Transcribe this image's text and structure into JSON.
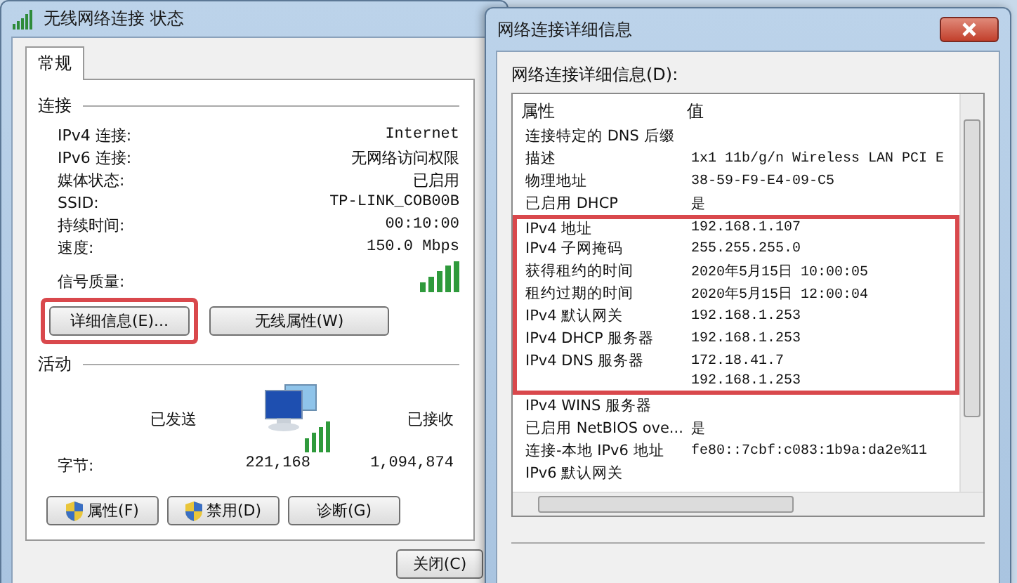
{
  "status_window": {
    "title": "无线网络连接 状态",
    "tabs": [
      {
        "label": "常规",
        "selected": true
      }
    ],
    "connection": {
      "heading": "连接",
      "fields": [
        {
          "label": "IPv4 连接:",
          "value": "Internet"
        },
        {
          "label": "IPv6 连接:",
          "value": "无网络访问权限"
        },
        {
          "label": "媒体状态:",
          "value": "已启用"
        },
        {
          "label": "SSID:",
          "value": "TP-LINK_COB00B"
        },
        {
          "label": "持续时间:",
          "value": "00:10:00"
        },
        {
          "label": "速度:",
          "value": "150.0 Mbps"
        }
      ],
      "signal_label": "信号质量:"
    },
    "buttons": [
      {
        "label": "详细信息(E)...",
        "highlighted": true
      },
      {
        "label": "无线属性(W)",
        "highlighted": false
      }
    ],
    "activity": {
      "heading": "活动",
      "sent_label": "已发送",
      "received_label": "已接收",
      "bytes_label": "字节:",
      "sent": "221,168",
      "received": "1,094,874"
    },
    "action_buttons": [
      {
        "label": "属性(F)",
        "kind": "shield"
      },
      {
        "label": "禁用(D)",
        "kind": "shield"
      },
      {
        "label": "诊断(G)",
        "kind": "plain"
      }
    ],
    "close_button": "关闭(C)"
  },
  "details_window": {
    "title": "网络连接详细信息",
    "list_label": "网络连接详细信息(D):",
    "columns": [
      "属性",
      "值"
    ],
    "rows": [
      {
        "property": "连接特定的 DNS 后缀",
        "value": "",
        "highlighted": false
      },
      {
        "property": "描述",
        "value": "1x1 11b/g/n Wireless LAN PCI E",
        "highlighted": false
      },
      {
        "property": "物理地址",
        "value": "38-59-F9-E4-09-C5",
        "highlighted": false
      },
      {
        "property": "已启用 DHCP",
        "value": "是",
        "highlighted": false
      },
      {
        "property": "IPv4 地址",
        "value": "192.168.1.107",
        "highlighted": true
      },
      {
        "property": "IPv4 子网掩码",
        "value": "255.255.255.0",
        "highlighted": true
      },
      {
        "property": "获得租约的时间",
        "value": "2020年5月15日 10:00:05",
        "highlighted": true
      },
      {
        "property": "租约过期的时间",
        "value": "2020年5月15日 12:00:04",
        "highlighted": true
      },
      {
        "property": "IPv4 默认网关",
        "value": "192.168.1.253",
        "highlighted": true
      },
      {
        "property": "IPv4 DHCP 服务器",
        "value": "192.168.1.253",
        "highlighted": true
      },
      {
        "property": "IPv4 DNS 服务器",
        "value": "172.18.41.7",
        "highlighted": true
      },
      {
        "property": "",
        "value": "192.168.1.253",
        "highlighted": true
      },
      {
        "property": "IPv4 WINS 服务器",
        "value": "",
        "highlighted": false
      },
      {
        "property": "已启用 NetBIOS ove...",
        "value": "是",
        "highlighted": false
      },
      {
        "property": "连接-本地 IPv6 地址",
        "value": "fe80::7cbf:c083:1b9a:da2e%11",
        "highlighted": false
      },
      {
        "property": "IPv6 默认网关",
        "value": "",
        "highlighted": false
      }
    ]
  }
}
